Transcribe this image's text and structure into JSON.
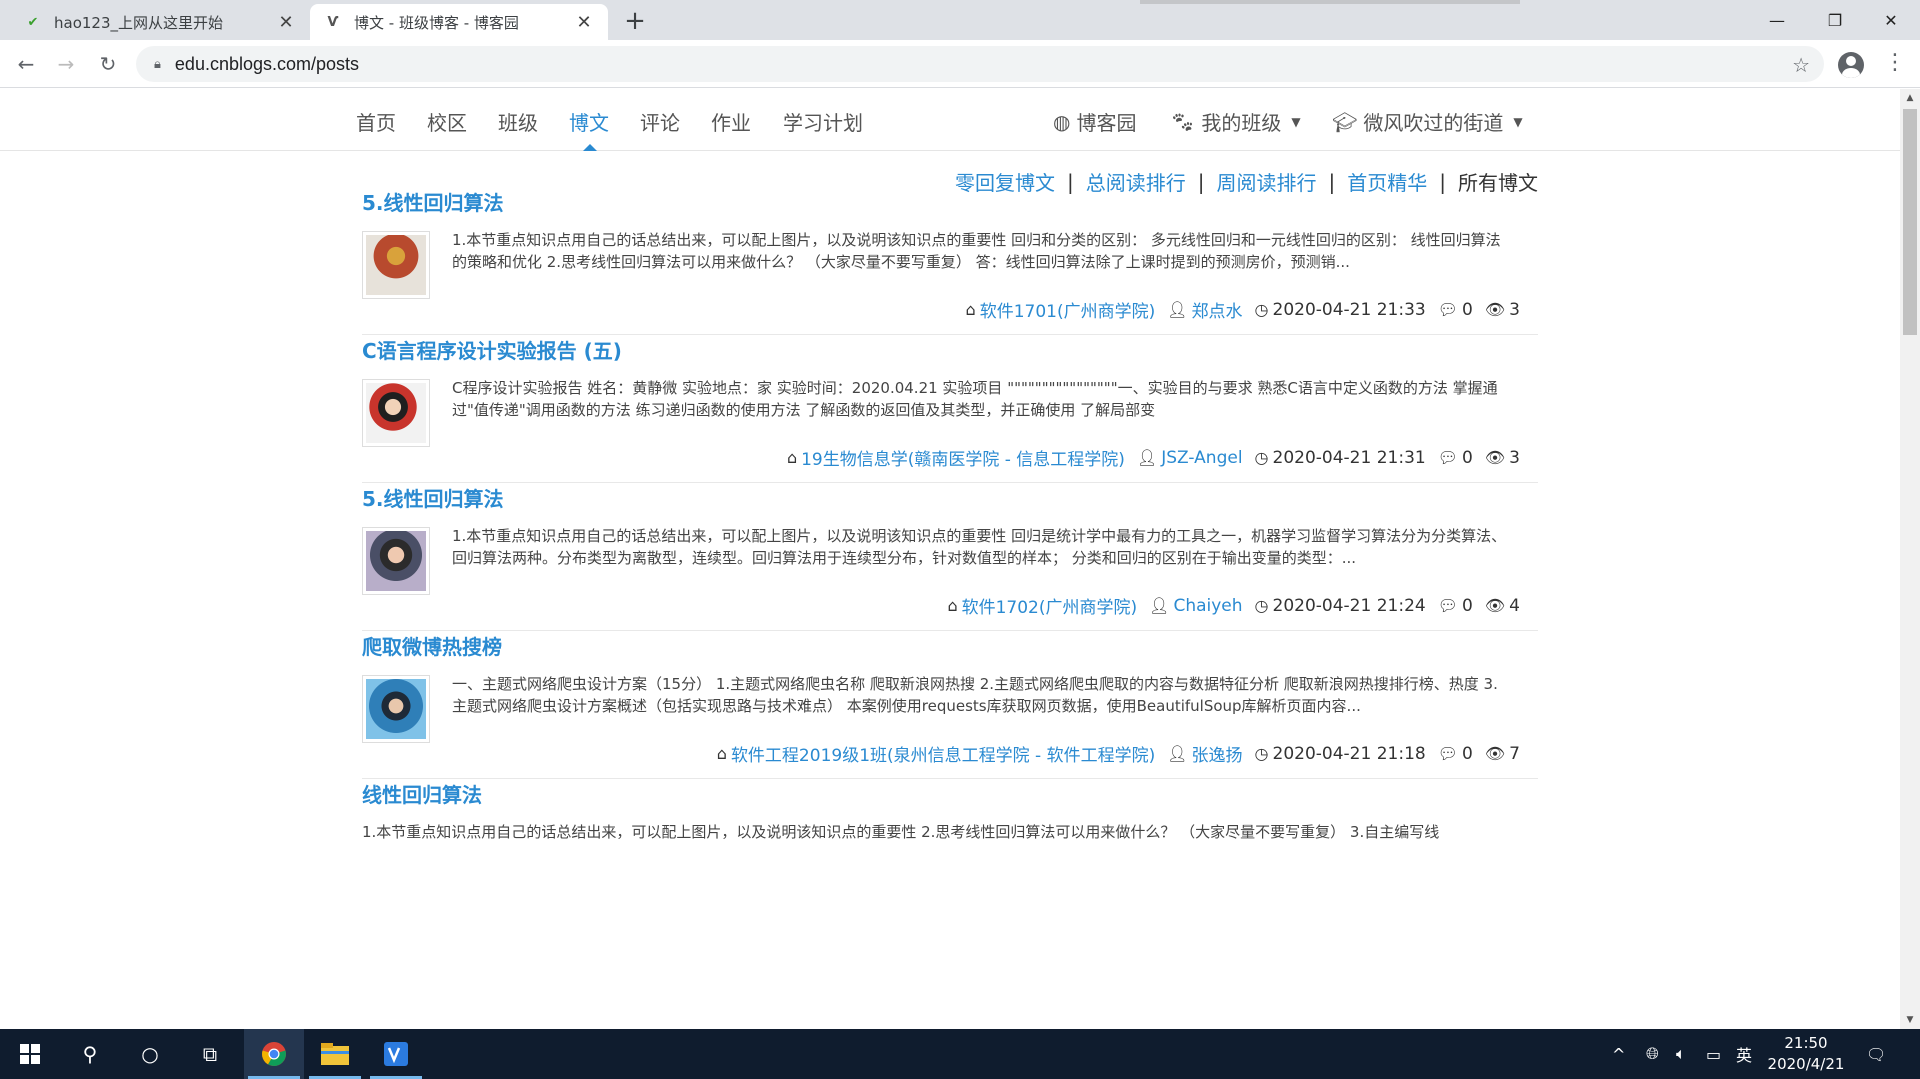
{
  "browser": {
    "tabs": [
      {
        "title": "hao123_上网从这里开始",
        "favicon": "hao123-icon",
        "active": false
      },
      {
        "title": "博文 - 班级博客 - 博客园",
        "favicon": "cnblogs-icon",
        "active": true
      }
    ],
    "new_tab_label": "+",
    "url": "edu.cnblogs.com/posts"
  },
  "site_nav": {
    "items": [
      "首页",
      "校区",
      "班级",
      "博文",
      "评论",
      "作业",
      "学习计划"
    ],
    "active": "博文",
    "right": {
      "cnblogs": "博客园",
      "my_class": "我的班级",
      "user": "微风吹过的街道"
    }
  },
  "filters": {
    "links": [
      "零回复博文",
      "总阅读排行",
      "周阅读排行",
      "首页精华"
    ],
    "current": "所有博文",
    "separator": "|"
  },
  "posts": [
    {
      "title": "5.线性回归算法",
      "summary": "1.本节重点知识点用自己的话总结出来，可以配上图片，以及说明该知识点的重要性 回归和分类的区别： 多元线性回归和一元线性回归的区别： 线性回归算法的策略和优化 2.思考线性回归算法可以用来做什么？ （大家尽量不要写重复） 答：线性回归算法除了上课时提到的预测房价，预测销...",
      "class": "软件1701(广州商学院)",
      "author": "郑点水",
      "time": "2020-04-21 21:33",
      "comments": "0",
      "views": "3",
      "avatar_color": "#b84a2e"
    },
    {
      "title": "C语言程序设计实验报告 (五)",
      "summary": "C程序设计实验报告 姓名：黄静微 实验地点：家 实验时间：2020.04.21 实验项目 \"\"\"\"\"\"\"\"\"\"\"\"\"\"\"\"一、实验目的与要求 熟悉C语言中定义函数的方法 掌握通过\"值传递\"调用函数的方法 练习递归函数的使用方法 了解函数的返回值及其类型，并正确使用 了解局部变",
      "class": "19生物信息学(赣南医学院 - 信息工程学院)",
      "author": "JSZ-Angel",
      "time": "2020-04-21 21:31",
      "comments": "0",
      "views": "3",
      "avatar_color": "#c8342c"
    },
    {
      "title": "5.线性回归算法",
      "summary": "1.本节重点知识点用自己的话总结出来，可以配上图片，以及说明该知识点的重要性 回归是统计学中最有力的工具之一，机器学习监督学习算法分为分类算法、回归算法两种。分布类型为离散型，连续型。回归算法用于连续型分布，针对数值型的样本； 分类和回归的区别在于输出变量的类型：...",
      "class": "软件1702(广州商学院)",
      "author": "Chaiyeh",
      "time": "2020-04-21 21:24",
      "comments": "0",
      "views": "4",
      "avatar_color": "#4a4f66"
    },
    {
      "title": "爬取微博热搜榜",
      "summary": "一、主题式网络爬虫设计方案（15分） 1.主题式网络爬虫名称 爬取新浪网热搜 2.主题式网络爬虫爬取的内容与数据特征分析 爬取新浪网热搜排行榜、热度 3.主题式网络爬虫设计方案概述（包括实现思路与技术难点） 本案例使用requests库获取网页数据，使用BeautifulSoup库解析页面内容...",
      "class": "软件工程2019级1班(泉州信息工程学院 - 软件工程学院)",
      "author": "张逸扬",
      "time": "2020-04-21 21:18",
      "comments": "0",
      "views": "7",
      "avatar_color": "#2f7fb8"
    },
    {
      "title": "线性回归算法",
      "summary": "1.本节重点知识点用自己的话总结出来，可以配上图片，以及说明该知识点的重要性 2.思考线性回归算法可以用来做什么？ （大家尽量不要写重复） 3.自主编写线"
    }
  ],
  "taskbar": {
    "time": "21:50",
    "date": "2020/4/21",
    "ime": "英"
  }
}
